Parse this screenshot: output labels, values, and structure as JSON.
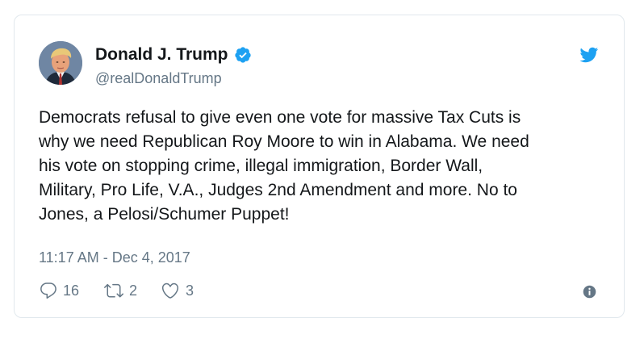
{
  "author": {
    "display_name": "Donald J. Trump",
    "handle": "@realDonaldTrump",
    "verified": true
  },
  "tweet": {
    "text": "Democrats refusal to give even one vote for massive Tax Cuts is\nwhy we need Republican Roy Moore to win in Alabama. We need\nhis vote on stopping crime, illegal immigration, Border Wall,\nMilitary, Pro Life, V.A., Judges 2nd Amendment and more. No to\nJones, a Pelosi/Schumer Puppet!",
    "timestamp": "11:17 AM - Dec 4, 2017"
  },
  "actions": {
    "replies": "16",
    "retweets": "2",
    "likes": "3"
  },
  "icons": {
    "verified": "verified-badge-icon",
    "brand": "twitter-bird-icon",
    "reply": "reply-icon",
    "retweet": "retweet-icon",
    "like": "heart-icon",
    "info": "info-icon"
  },
  "colors": {
    "brand_blue": "#1da1f2",
    "text_primary": "#14171a",
    "text_secondary": "#657786",
    "border": "#e1e8ed"
  }
}
